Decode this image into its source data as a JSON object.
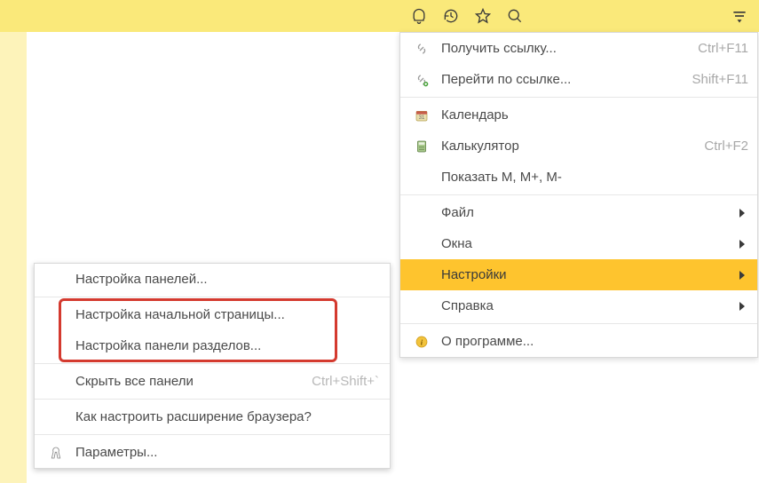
{
  "toolbar": {},
  "main_menu": {
    "get_link": {
      "label": "Получить ссылку...",
      "shortcut": "Ctrl+F11"
    },
    "go_link": {
      "label": "Перейти по ссылке...",
      "shortcut": "Shift+F11"
    },
    "calendar": {
      "label": "Календарь"
    },
    "calculator": {
      "label": "Калькулятор",
      "shortcut": "Ctrl+F2"
    },
    "show_mem": {
      "label": "Показать M, M+, M-"
    },
    "file": {
      "label": "Файл"
    },
    "windows": {
      "label": "Окна"
    },
    "settings": {
      "label": "Настройки"
    },
    "help": {
      "label": "Справка"
    },
    "about": {
      "label": "О программе..."
    }
  },
  "sub_menu": {
    "panels": {
      "label": "Настройка панелей..."
    },
    "start_page": {
      "label": "Настройка начальной страницы..."
    },
    "sections": {
      "label": "Настройка панели разделов..."
    },
    "hide_panels": {
      "label": "Скрыть все панели",
      "shortcut": "Ctrl+Shift+`"
    },
    "browser_ext": {
      "label": "Как настроить расширение браузера?"
    },
    "parameters": {
      "label": "Параметры..."
    }
  }
}
